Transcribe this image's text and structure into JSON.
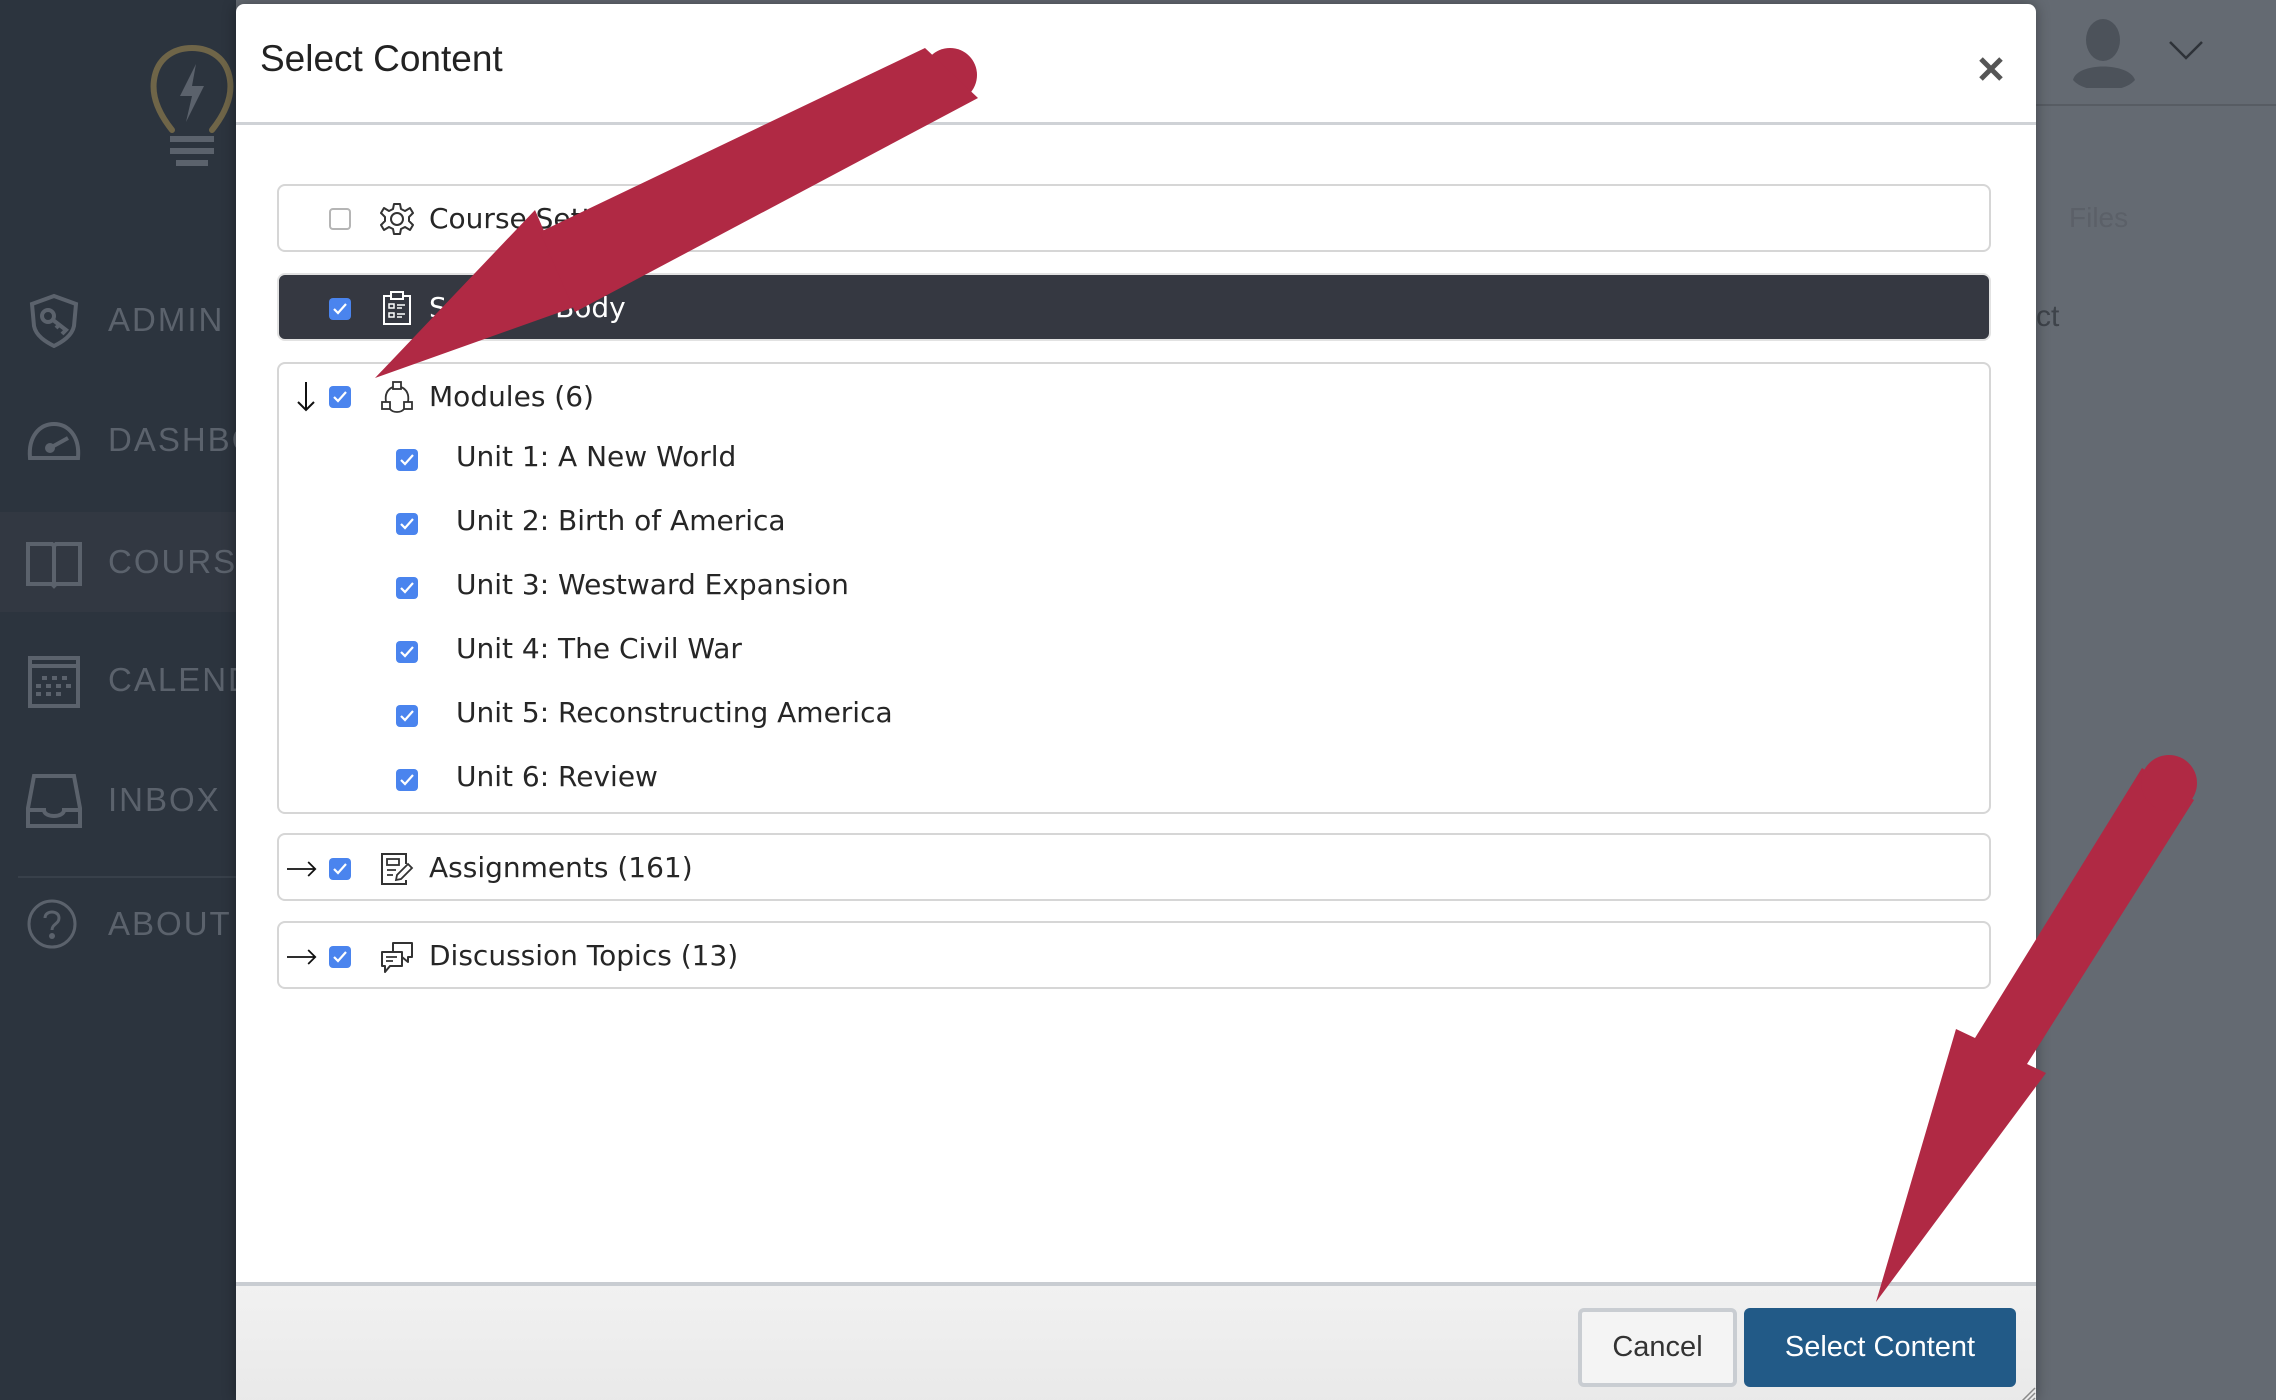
{
  "sidebar": {
    "items": [
      {
        "label": "ADMIN",
        "icon": "shield-key-icon",
        "active": false
      },
      {
        "label": "DASHBOARD",
        "icon": "speedometer-icon",
        "active": false
      },
      {
        "label": "COURSES",
        "icon": "book-icon",
        "active": true
      },
      {
        "label": "CALENDAR",
        "icon": "calendar-icon",
        "active": false
      },
      {
        "label": "INBOX",
        "icon": "inbox-icon",
        "active": false
      },
      {
        "label": "ABOUT",
        "icon": "help-circle-icon",
        "active": false
      }
    ]
  },
  "background": {
    "files_tab": "Files",
    "partial_text": "ct"
  },
  "modal": {
    "title": "Select Content",
    "close_label": "×",
    "items": [
      {
        "label": "Course Settings",
        "icon": "gear-icon",
        "checked": false,
        "highlighted": false
      },
      {
        "label": "Syllabus Body",
        "visible_label": "Syl",
        "visible_tail": "y",
        "icon": "clipboard-list-icon",
        "checked": true,
        "highlighted": true
      },
      {
        "label": "Modules (6)",
        "icon": "modules-icon",
        "checked": true,
        "expanded": true,
        "expander": "↓",
        "children": [
          {
            "label": "Unit 1: A New World",
            "checked": true
          },
          {
            "label": "Unit 2: Birth of America",
            "checked": true
          },
          {
            "label": "Unit 3: Westward Expansion",
            "checked": true
          },
          {
            "label": "Unit 4: The Civil War",
            "checked": true
          },
          {
            "label": "Unit 5: Reconstructing America",
            "checked": true
          },
          {
            "label": "Unit 6: Review",
            "checked": true
          }
        ]
      },
      {
        "label": "Assignments (161)",
        "icon": "assignment-edit-icon",
        "checked": true,
        "expanded": false,
        "expander": "→"
      },
      {
        "label": "Discussion Topics (13)",
        "icon": "discussion-icon",
        "checked": true,
        "expanded": false,
        "expander": "→"
      }
    ],
    "footer": {
      "cancel_label": "Cancel",
      "submit_label": "Select Content"
    }
  },
  "colors": {
    "primary": "#225a87",
    "checkbox": "#4a84ee",
    "highlight_row": "#353841",
    "annotation_arrow": "#b02944",
    "sidebar_bg": "#2c343e"
  }
}
